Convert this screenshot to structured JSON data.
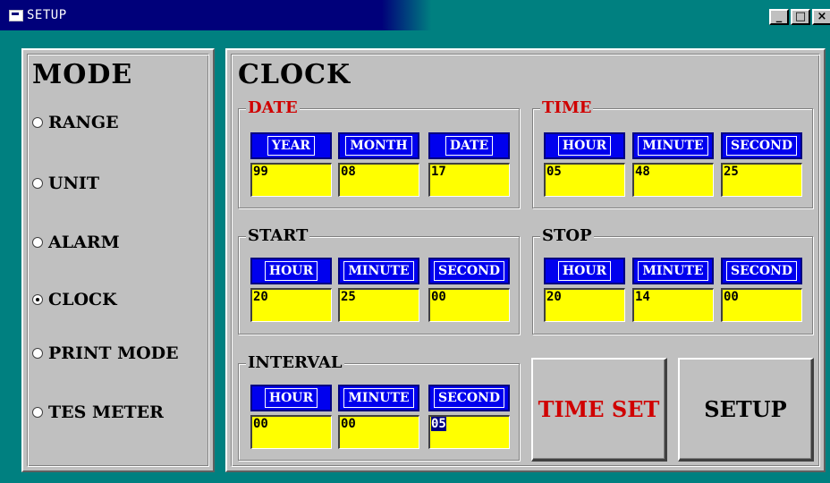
{
  "window": {
    "title": "SETUP",
    "minimize": "_",
    "maximize": "□",
    "close": "×"
  },
  "mode": {
    "title": "MODE",
    "options": [
      {
        "label": "RANGE",
        "selected": false
      },
      {
        "label": "UNIT",
        "selected": false
      },
      {
        "label": "ALARM",
        "selected": false
      },
      {
        "label": "CLOCK",
        "selected": true
      },
      {
        "label": "PRINT MODE",
        "selected": false
      },
      {
        "label": "TES METER",
        "selected": false
      }
    ]
  },
  "clock": {
    "title": "CLOCK",
    "date": {
      "label": "DATE",
      "fields": [
        {
          "label": "YEAR",
          "value": "99"
        },
        {
          "label": "MONTH",
          "value": "08"
        },
        {
          "label": "DATE",
          "value": "17"
        }
      ]
    },
    "time": {
      "label": "TIME",
      "fields": [
        {
          "label": "HOUR",
          "value": "05"
        },
        {
          "label": "MINUTE",
          "value": "48"
        },
        {
          "label": "SECOND",
          "value": "25"
        }
      ]
    },
    "start": {
      "label": "START",
      "fields": [
        {
          "label": "HOUR",
          "value": "20"
        },
        {
          "label": "MINUTE",
          "value": "25"
        },
        {
          "label": "SECOND",
          "value": "00"
        }
      ]
    },
    "stop": {
      "label": "STOP",
      "fields": [
        {
          "label": "HOUR",
          "value": "20"
        },
        {
          "label": "MINUTE",
          "value": "14"
        },
        {
          "label": "SECOND",
          "value": "00"
        }
      ]
    },
    "interval": {
      "label": "INTERVAL",
      "fields": [
        {
          "label": "HOUR",
          "value": "00"
        },
        {
          "label": "MINUTE",
          "value": "00"
        },
        {
          "label": "SECOND",
          "value": "05"
        }
      ]
    },
    "buttons": {
      "time_set": "TIME SET",
      "setup": "SETUP"
    }
  },
  "colors": {
    "title_bar": "#00007a",
    "desktop": "#008080",
    "panel": "#c0c0c0",
    "field_label_bg": "#0000ee",
    "field_value_bg": "#ffff00",
    "accent_red": "#d00000"
  }
}
